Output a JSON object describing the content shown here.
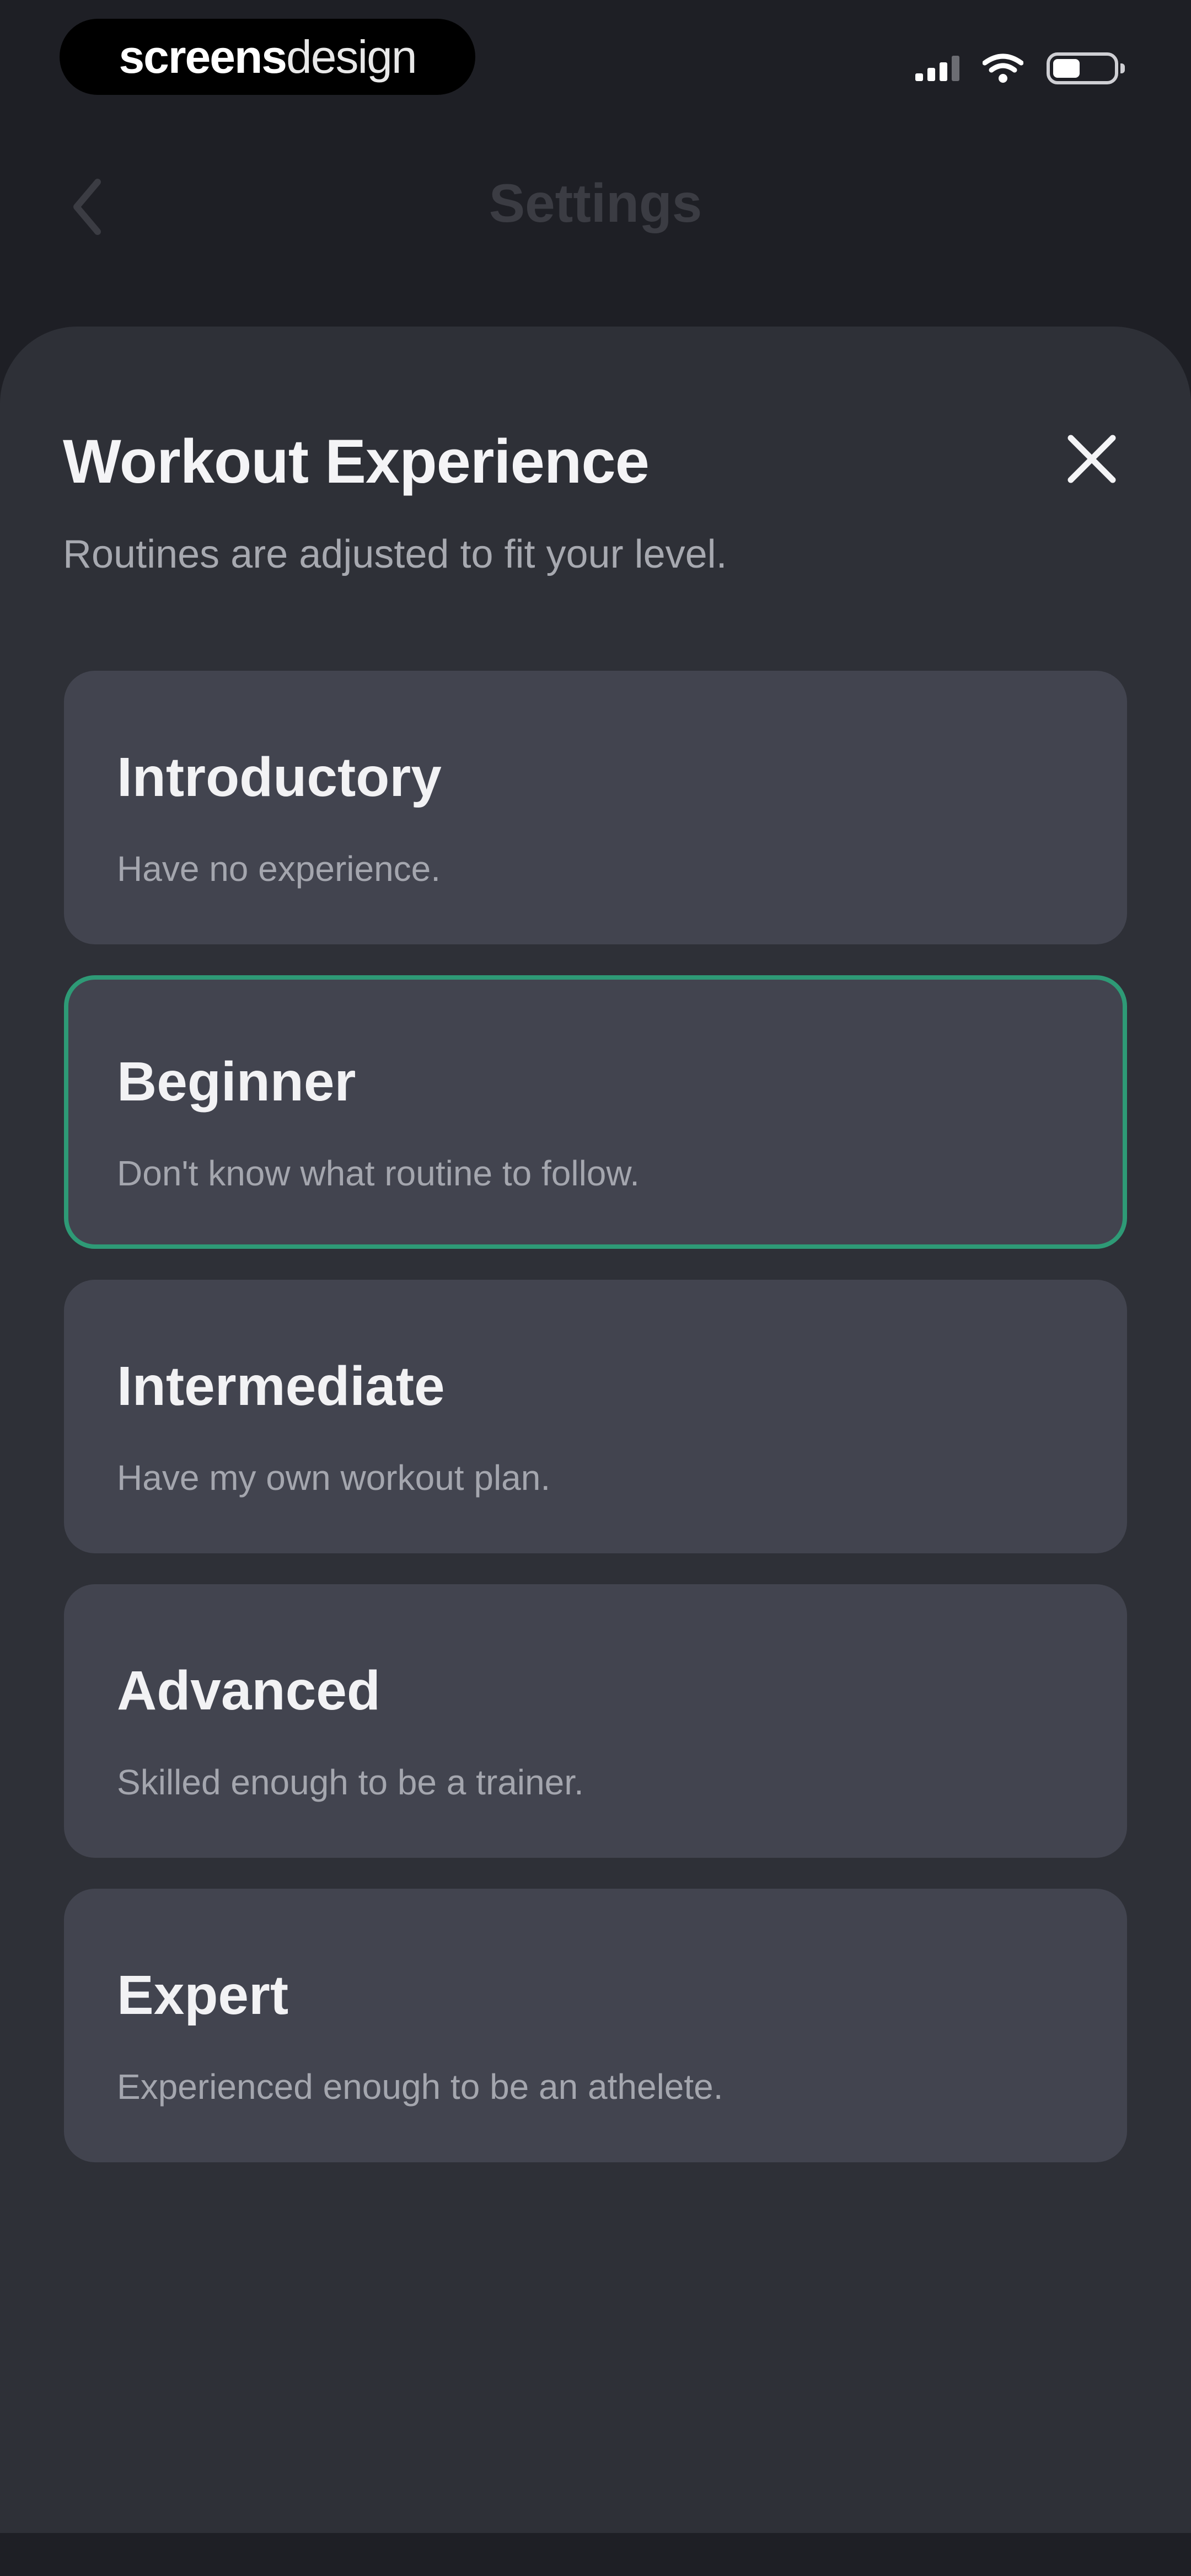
{
  "status_bar": {
    "brand_bold": "screens",
    "brand_light": "design",
    "signal_icon": "signal-bars-icon",
    "wifi_icon": "wifi-icon",
    "battery_icon": "battery-icon",
    "battery_level": 0.45
  },
  "nav": {
    "back_icon": "chevron-left-icon",
    "title": "Settings"
  },
  "sheet": {
    "title": "Workout Experience",
    "subtitle": "Routines are adjusted to fit your level.",
    "close_icon": "close-icon",
    "accent_color": "#2e9a76",
    "options": [
      {
        "label": "Introductory",
        "description": "Have no experience.",
        "selected": false
      },
      {
        "label": "Beginner",
        "description": "Don't know what routine to follow.",
        "selected": true
      },
      {
        "label": "Intermediate",
        "description": "Have my own workout plan.",
        "selected": false
      },
      {
        "label": "Advanced",
        "description": "Skilled enough to be a trainer.",
        "selected": false
      },
      {
        "label": "Expert",
        "description": "Experienced enough to be an athelete.",
        "selected": false
      }
    ]
  }
}
